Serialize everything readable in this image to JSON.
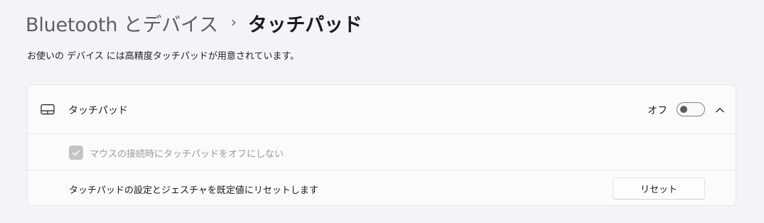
{
  "breadcrumb": {
    "parent": "Bluetooth とデバイス",
    "separator": "›",
    "current": "タッチパッド"
  },
  "description": "お使いの デバイス には高精度タッチパッドが用意されています。",
  "touchpad_section": {
    "icon": "touchpad-icon",
    "title": "タッチパッド",
    "toggle_state_label": "オフ",
    "toggle_on": false,
    "expanded": true,
    "expand_icon": "chevron-up-icon"
  },
  "mouse_option": {
    "label": "マウスの接続時にタッチパッドをオフにしない",
    "checked": true,
    "disabled": true,
    "icon": "checkmark-icon"
  },
  "reset_option": {
    "label": "タッチパッドの設定とジェスチャを既定値にリセットします",
    "button_label": "リセット"
  },
  "colors": {
    "page_background": "#f3f4f8",
    "card_background": "#fbfbfc",
    "disabled_text": "#9a9a9a"
  }
}
